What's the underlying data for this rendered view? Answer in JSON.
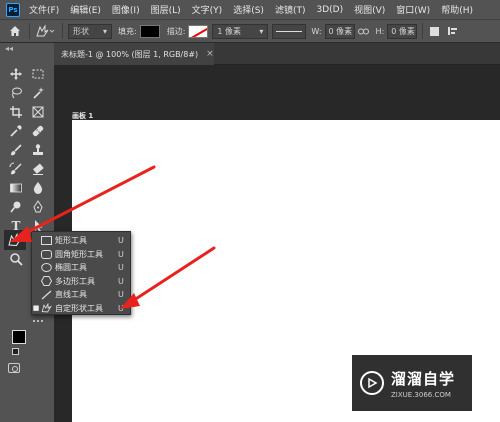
{
  "app": {
    "logo_text": "Ps"
  },
  "menu": [
    "文件(F)",
    "编辑(E)",
    "图像(I)",
    "图层(L)",
    "文字(Y)",
    "选择(S)",
    "滤镜(T)",
    "3D(D)",
    "视图(V)",
    "窗口(W)",
    "帮助(H)"
  ],
  "options": {
    "mode_value": "形状",
    "fill_label": "填充:",
    "stroke_label": "描边:",
    "stroke_width": "1 像素",
    "w_label": "W:",
    "w_value": "0 像素",
    "h_label": "H:",
    "h_value": "0 像素"
  },
  "document": {
    "tab_title": "未标题-1 @ 100% (图层 1, RGB/8#)",
    "tab_close": "×",
    "artboard_label": "画板 1"
  },
  "toolbar": {
    "text_tool_letter": "T",
    "collapse_glyph": "◂◂"
  },
  "flyout": {
    "items": [
      {
        "label": "矩形工具",
        "key": "U",
        "icon": "rectangle-icon",
        "selected": false
      },
      {
        "label": "圆角矩形工具",
        "key": "U",
        "icon": "rounded-rectangle-icon",
        "selected": false
      },
      {
        "label": "椭圆工具",
        "key": "U",
        "icon": "ellipse-icon",
        "selected": false
      },
      {
        "label": "多边形工具",
        "key": "U",
        "icon": "polygon-icon",
        "selected": false
      },
      {
        "label": "直线工具",
        "key": "U",
        "icon": "line-icon",
        "selected": false
      },
      {
        "label": "自定形状工具",
        "key": "U",
        "icon": "custom-shape-icon",
        "selected": true
      }
    ],
    "selected_bullet": "■"
  },
  "watermark": {
    "title": "溜溜自学",
    "url": "ZIXUE.3066.COM"
  },
  "colors": {
    "menubar": "#535353",
    "canvas": "#ffffff",
    "arrow": "#e8231e",
    "foreground": "#000000",
    "background": "#ffffff"
  }
}
